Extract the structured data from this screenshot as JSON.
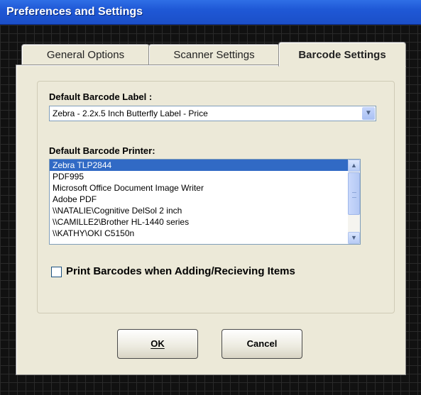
{
  "window": {
    "title": "Preferences and Settings"
  },
  "tabs": [
    {
      "label": "General Options"
    },
    {
      "label": "Scanner Settings"
    },
    {
      "label": "Barcode Settings",
      "active": true
    }
  ],
  "barcode_settings": {
    "label_title": "Default Barcode Label :",
    "label_value": "Zebra - 2.2x.5 Inch Butterfly Label - Price",
    "printer_title": "Default Barcode Printer:",
    "printers": [
      "Zebra  TLP2844",
      "PDF995",
      "Microsoft Office Document Image Writer",
      "Adobe PDF",
      "\\\\NATALIE\\Cognitive DelSol 2 inch",
      "\\\\CAMILLE2\\Brother HL-1440 series",
      "\\\\KATHY\\OKI C5150n"
    ],
    "selected_printer": "Zebra  TLP2844",
    "print_checkbox_label": "Print Barcodes when Adding/Recieving Items",
    "print_checkbox_checked": false
  },
  "buttons": {
    "ok": "OK",
    "cancel": "Cancel"
  },
  "icons": {
    "combo_arrow": "chevron-down-icon",
    "scroll_up": "scroll-up-icon",
    "scroll_down": "scroll-down-icon"
  },
  "colors": {
    "titlebar": "#1f58d6",
    "selection": "#316ac5",
    "panel": "#ece9d8"
  }
}
